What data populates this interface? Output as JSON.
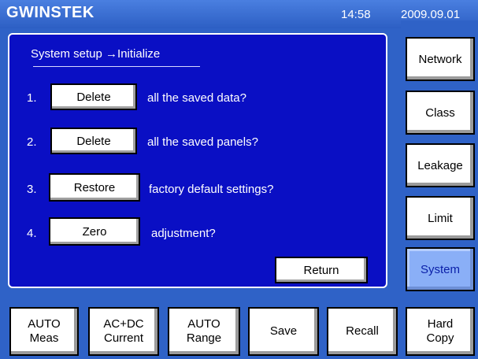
{
  "header": {
    "brand": "GWINSTEK",
    "time": "14:58",
    "date": "2009.09.01"
  },
  "panel": {
    "heading": "System setup →Initialize",
    "items": [
      {
        "num": "1.",
        "button": "Delete",
        "text": "all the saved data?"
      },
      {
        "num": "2.",
        "button": "Delete",
        "text": "all the saved panels?"
      },
      {
        "num": "3.",
        "button": "Restore",
        "text": "factory default settings?"
      },
      {
        "num": "4.",
        "button": "Zero",
        "text": "adjustment?"
      }
    ],
    "return_label": "Return"
  },
  "side": {
    "items": [
      {
        "label": "Network"
      },
      {
        "label": "Class"
      },
      {
        "label": "Leakage"
      },
      {
        "label": "Limit"
      },
      {
        "label": "System",
        "active": true
      }
    ]
  },
  "bottom": {
    "items": [
      {
        "line1": "AUTO",
        "line2": "Meas"
      },
      {
        "line1": "AC+DC",
        "line2": "Current"
      },
      {
        "line1": "AUTO",
        "line2": "Range"
      },
      {
        "line1": "Save",
        "line2": ""
      },
      {
        "line1": "Recall",
        "line2": ""
      },
      {
        "line1": "Hard",
        "line2": "Copy"
      }
    ]
  },
  "colors": {
    "background": "#2f62c7",
    "panel": "#0a0fc4",
    "active": "#8aaff7"
  }
}
